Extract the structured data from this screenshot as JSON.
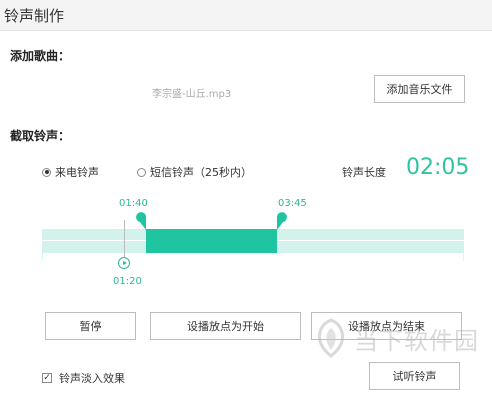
{
  "window": {
    "title": "铃声制作"
  },
  "add_song": {
    "label": "添加歌曲：",
    "filename": "李宗盛-山丘.mp3",
    "add_button": "添加音乐文件"
  },
  "cut": {
    "label": "截取铃声：",
    "radio_call": "来电铃声",
    "radio_sms": "短信铃声（25秒内）",
    "selected": "来电铃声",
    "length_label": "铃声长度",
    "length_value": "02:05"
  },
  "timeline": {
    "start_time": "01:40",
    "end_time": "03:45",
    "play_time": "01:20"
  },
  "buttons": {
    "pause": "暂停",
    "set_start": "设播放点为开始",
    "set_end": "设播放点为结束",
    "preview": "试听铃声"
  },
  "fade": {
    "label": "铃声淡入效果",
    "checked": true
  },
  "watermark": {
    "text": "当下软件园"
  },
  "colors": {
    "accent": "#1fc4a0",
    "track": "#d4f2ec"
  }
}
